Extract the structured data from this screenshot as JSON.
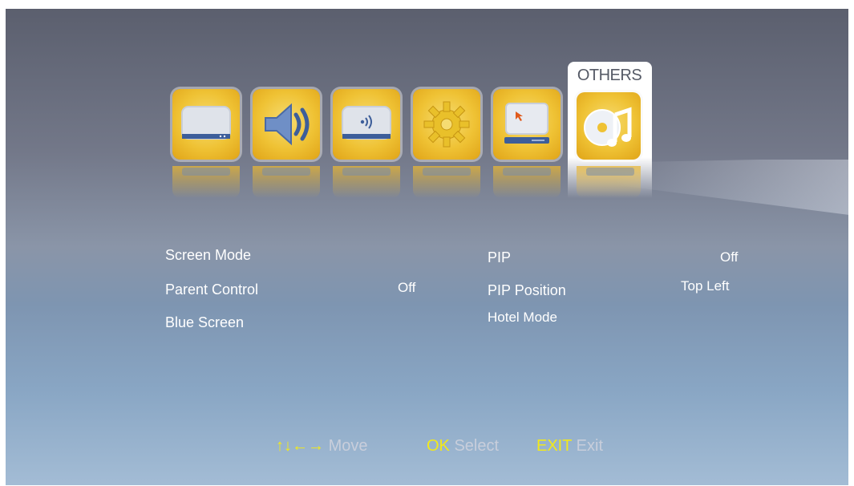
{
  "tabs": [
    {
      "name": "picture-icon"
    },
    {
      "name": "sound-icon"
    },
    {
      "name": "channel-icon"
    },
    {
      "name": "setup-icon"
    },
    {
      "name": "pc-icon"
    },
    {
      "name": "others-icon",
      "label": "OTHERS",
      "active": true
    }
  ],
  "left_items": [
    {
      "label": "Screen Mode",
      "value": ""
    },
    {
      "label": "Parent Control",
      "value": "Off"
    },
    {
      "label": "Blue Screen",
      "value": ""
    }
  ],
  "right_items": [
    {
      "label": "PIP",
      "value": "Off"
    },
    {
      "label": "PIP Position",
      "value": "Top Left"
    },
    {
      "label": "Hotel Mode",
      "value": ""
    }
  ],
  "footer": {
    "move_key": "↑↓←→",
    "move_label": "Move",
    "ok_key": "OK",
    "ok_label": "Select",
    "exit_key": "EXIT",
    "exit_label": "Exit"
  },
  "colors": {
    "tile_yellow": "#efc234",
    "hint_key": "#f2e91b",
    "hint_text": "#c8cedb"
  }
}
